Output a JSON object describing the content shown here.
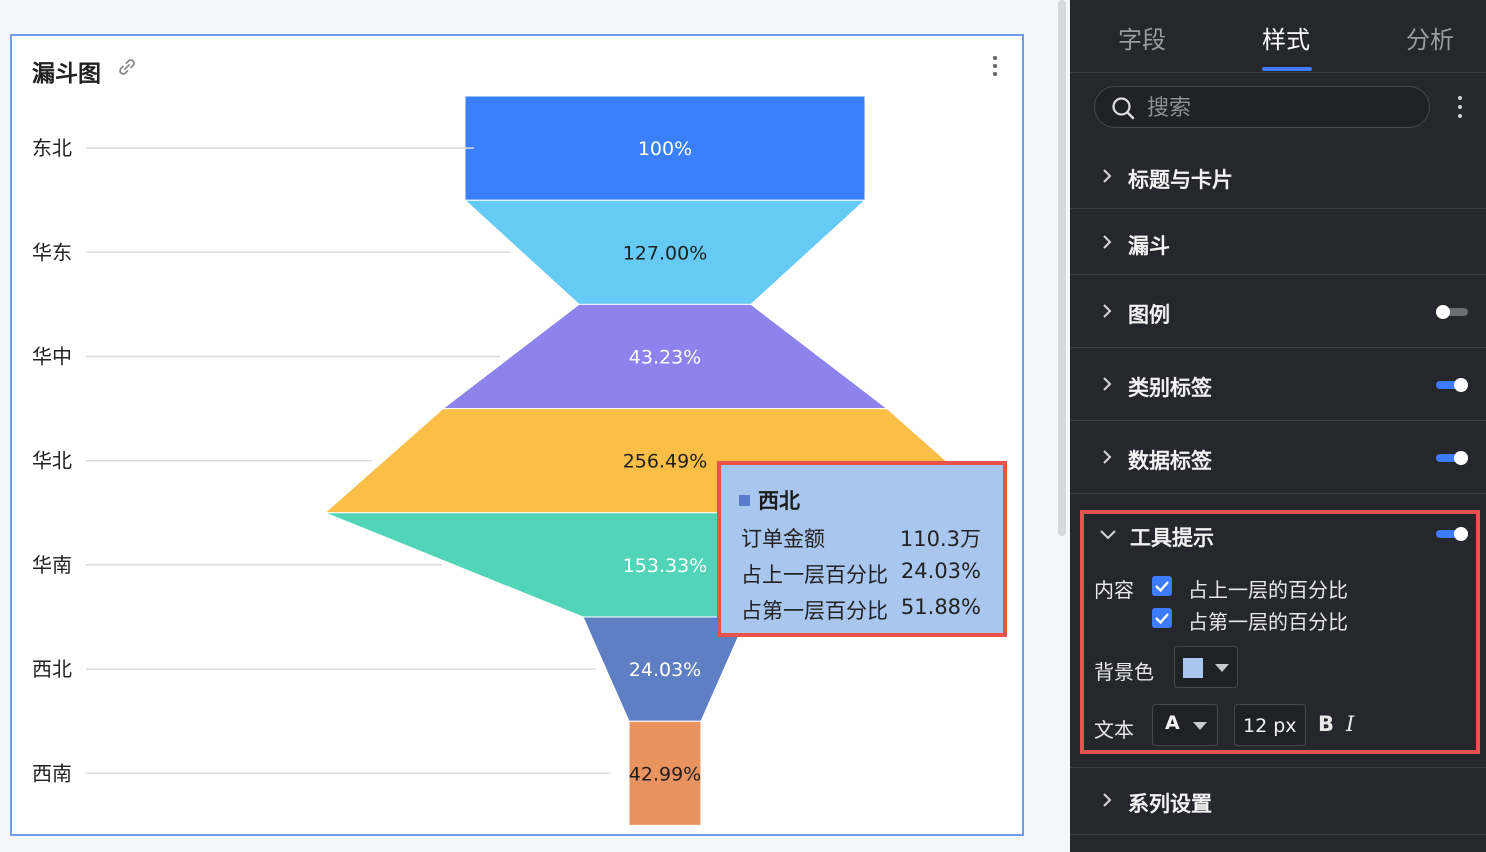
{
  "card": {
    "title": "漏斗图"
  },
  "chart_data": {
    "type": "funnel",
    "categories": [
      "东北",
      "华东",
      "华中",
      "华北",
      "华南",
      "西北",
      "西南"
    ],
    "labels": [
      "100%",
      "127.00%",
      "43.23%",
      "256.49%",
      "153.33%",
      "24.03%",
      "42.99%"
    ],
    "colors": [
      "#3a7ffb",
      "#66cbf4",
      "#8c84ec",
      "#fbbf47",
      "#52d4b8",
      "#5f7fc4",
      "#e9935e"
    ],
    "label_colors": [
      "#ffffff",
      "#1f1f1f",
      "#ffffff",
      "#1f1f1f",
      "#ffffff",
      "#ffffff",
      "#1f1f1f"
    ]
  },
  "tooltip": {
    "title": "西北",
    "rows": [
      {
        "label": "订单金额",
        "value": "110.3万"
      },
      {
        "label": "占上一层百分比",
        "value": "24.03%"
      },
      {
        "label": "占第一层百分比",
        "value": "51.88%"
      }
    ]
  },
  "panel": {
    "tabs": [
      "字段",
      "样式",
      "分析"
    ],
    "active_tab": "样式",
    "search_placeholder": "搜索",
    "sections": [
      {
        "label": "标题与卡片"
      },
      {
        "label": "漏斗"
      },
      {
        "label": "图例",
        "toggle": false
      },
      {
        "label": "类别标签",
        "toggle": true
      },
      {
        "label": "数据标签",
        "toggle": true
      }
    ],
    "tooltip_section": {
      "label": "工具提示",
      "toggle": true,
      "content_label": "内容",
      "options": [
        "占上一层的百分比",
        "占第一层的百分比"
      ],
      "bg_label": "背景色",
      "bg_color": "#a8c6ee",
      "text_label": "文本",
      "font_glyph": "A",
      "font_size": "12 px",
      "bold_label": "B",
      "italic_label": "I"
    },
    "series_section": {
      "label": "系列设置"
    }
  },
  "colors": {
    "accent": "#3d7cff",
    "highlight": "#e8524a"
  }
}
